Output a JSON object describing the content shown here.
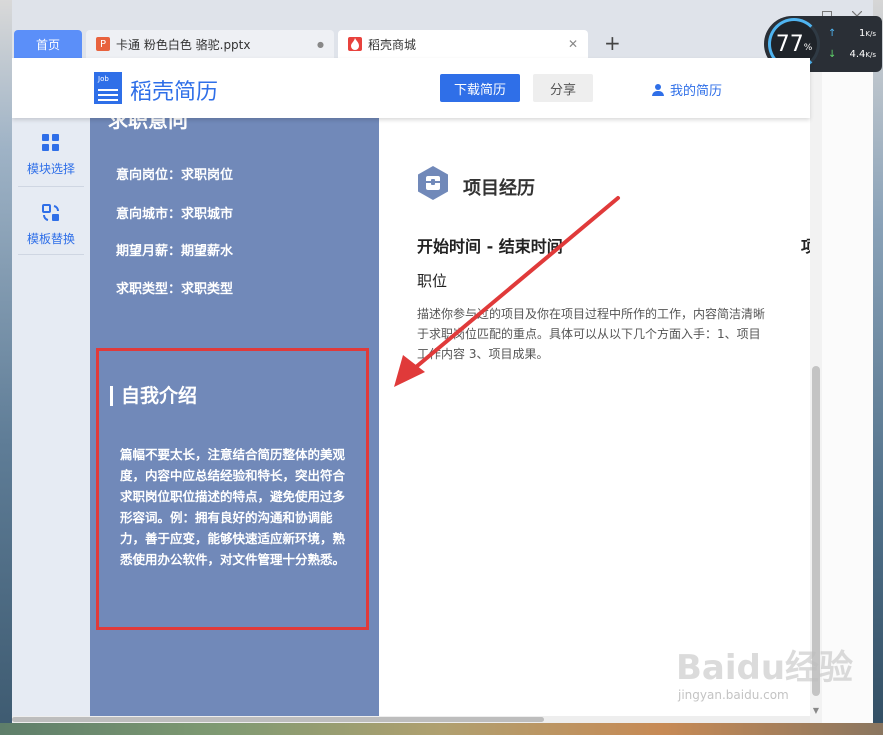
{
  "browser": {
    "home_tab": "首页",
    "tabs": [
      {
        "label": "卡通 粉色白色 骆驼.pptx",
        "icon": "P"
      },
      {
        "label": "稻壳商城"
      }
    ],
    "add_tab": "+",
    "close_glyph": "✕",
    "dot_glyph": "●"
  },
  "speed_widget": {
    "percent": "77",
    "unit": "%",
    "up": "1",
    "up_unit": "K/s",
    "down": "4.4",
    "down_unit": "K/s"
  },
  "header": {
    "logo_small": "Job",
    "logo_text": "稻壳简历",
    "download_btn": "下载简历",
    "share_btn": "分享",
    "my_resume": "我的简历"
  },
  "sidebar": {
    "items": [
      {
        "label": "模块选择"
      },
      {
        "label": "模板替换"
      }
    ]
  },
  "resume": {
    "left": {
      "cut_heading": "求职意向",
      "fields": [
        {
          "text": "意向岗位：求职岗位"
        },
        {
          "text": "意向城市：求职城市"
        },
        {
          "text": "期望月薪：期望薪水"
        },
        {
          "text": "求职类型：求职类型"
        }
      ],
      "self_title": "自我介绍",
      "self_text": "篇幅不要太长，注意结合简历整体的美观度，内容中应总结经验和特长，突出符合求职岗位职位描述的特点，避免使用过多形容词。例：拥有良好的沟通和协调能力，善于应变，能够快速适应新环境，熟悉使用办公软件，对文件管理十分熟悉。"
    },
    "right": {
      "section_title": "项目经历",
      "time_range": "开始时间 - 结束时间",
      "trunc": "项",
      "role": "职位",
      "desc_lines": [
        "描述你参与过的项目及你在项目过程中所作的工作，内容简洁清晰",
        "于求职岗位匹配的重点。具体可以从以下几个方面入手：1、项目",
        "工作内容 3、项目成果。"
      ]
    }
  },
  "watermark": {
    "main": "Baidu经验",
    "sub": "jingyan.baidu.com"
  },
  "colors": {
    "accent": "#2f6fe8",
    "resume_left": "#7189b9",
    "annotation": "#e03a3a"
  }
}
